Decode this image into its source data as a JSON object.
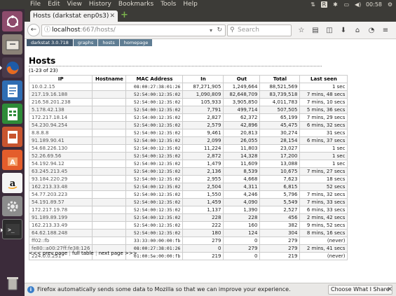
{
  "menubar": {
    "items": [
      "File",
      "Edit",
      "View",
      "History",
      "Bookmarks",
      "Tools",
      "Help"
    ],
    "clock": "00:58"
  },
  "browser": {
    "tab_title": "Hosts (darkstat enp0s3)",
    "url_host": "localhost",
    "url_rest": ":667/hosts/",
    "search_placeholder": "Search"
  },
  "page": {
    "nav": [
      "darkstat 3.0.718",
      "graphs",
      "hosts",
      "homepage"
    ],
    "title": "Hosts",
    "count": "(1-23 of 23)",
    "columns": [
      "IP",
      "Hostname",
      "MAC Address",
      "In",
      "Out",
      "Total",
      "Last seen"
    ],
    "rows": [
      [
        "10.0.2.15",
        "",
        "08:00:27:38:01:26",
        "87,271,905",
        "1,249,664",
        "88,521,569",
        "1 sec"
      ],
      [
        "217.19.16.188",
        "",
        "52:54:00:12:35:02",
        "1,090,809",
        "82,648,709",
        "83,739,518",
        "7 mins, 48 secs"
      ],
      [
        "216.58.201.238",
        "",
        "52:54:00:12:35:02",
        "105,933",
        "3,905,850",
        "4,011,783",
        "7 mins, 10 secs"
      ],
      [
        "5.178.42.138",
        "",
        "52:54:00:12:35:02",
        "7,791",
        "499,714",
        "507,505",
        "5 mins, 36 secs"
      ],
      [
        "172.217.18.14",
        "",
        "52:54:00:12:35:02",
        "2,827",
        "62,372",
        "65,199",
        "7 mins, 29 secs"
      ],
      [
        "54.230.94.254",
        "",
        "52:54:00:12:35:02",
        "2,579",
        "42,896",
        "45,475",
        "6 mins, 32 secs"
      ],
      [
        "8.8.8.8",
        "",
        "52:54:00:12:35:02",
        "9,461",
        "20,813",
        "30,274",
        "31 secs"
      ],
      [
        "91.189.90.41",
        "",
        "52:54:00:12:35:02",
        "2,099",
        "26,055",
        "28,154",
        "6 mins, 37 secs"
      ],
      [
        "54.68.226.130",
        "",
        "52:54:00:12:35:02",
        "11,224",
        "11,803",
        "23,027",
        "1 sec"
      ],
      [
        "52.26.69.56",
        "",
        "52:54:00:12:35:02",
        "2,872",
        "14,328",
        "17,200",
        "1 sec"
      ],
      [
        "54.192.94.12",
        "",
        "52:54:00:12:35:02",
        "1,479",
        "11,609",
        "13,088",
        "1 sec"
      ],
      [
        "63.245.213.45",
        "",
        "52:54:00:12:35:02",
        "2,136",
        "8,539",
        "10,675",
        "7 mins, 27 secs"
      ],
      [
        "93.184.220.29",
        "",
        "52:54:00:12:35:02",
        "2,955",
        "4,668",
        "7,623",
        "18 secs"
      ],
      [
        "162.213.33.48",
        "",
        "52:54:00:12:35:02",
        "2,504",
        "4,311",
        "6,815",
        "52 secs"
      ],
      [
        "54.77.203.223",
        "",
        "52:54:00:12:35:02",
        "1,550",
        "4,246",
        "5,796",
        "7 mins, 32 secs"
      ],
      [
        "54.191.89.57",
        "",
        "52:54:00:12:35:02",
        "1,459",
        "4,090",
        "5,549",
        "7 mins, 33 secs"
      ],
      [
        "172.217.19.78",
        "",
        "52:54:00:12:35:02",
        "1,137",
        "1,390",
        "2,527",
        "6 mins, 33 secs"
      ],
      [
        "91.189.89.199",
        "",
        "52:54:00:12:35:02",
        "228",
        "228",
        "456",
        "2 mins, 42 secs"
      ],
      [
        "162.213.33.49",
        "",
        "52:54:00:12:35:02",
        "222",
        "160",
        "382",
        "9 mins, 52 secs"
      ],
      [
        "64.62.188.248",
        "",
        "52:54:00:12:35:02",
        "180",
        "124",
        "304",
        "8 mins, 16 secs"
      ],
      [
        "ff02::fb",
        "",
        "33:33:00:00:00:fb",
        "279",
        "0",
        "279",
        "(never)"
      ],
      [
        "fe80::a00:27ff:fe38:126",
        "",
        "08:00:27:38:01:26",
        "0",
        "279",
        "279",
        "2 mins, 41 secs"
      ],
      [
        "224.0.0.251",
        "",
        "01:00:5e:00:00:fb",
        "219",
        "0",
        "219",
        "(never)"
      ]
    ],
    "pager": {
      "prev": "<<< prev page",
      "full": "full table",
      "next": "next page >>>"
    }
  },
  "notification": {
    "text": "Firefox automatically sends some data to Mozilla so that we can improve your experience.",
    "button": "Choose What I Share"
  },
  "colors": {
    "launcher_bg": "#3b2b3a",
    "topbar_bg": "#3c3b37",
    "nav_tab_bg": "#5f7d93"
  }
}
